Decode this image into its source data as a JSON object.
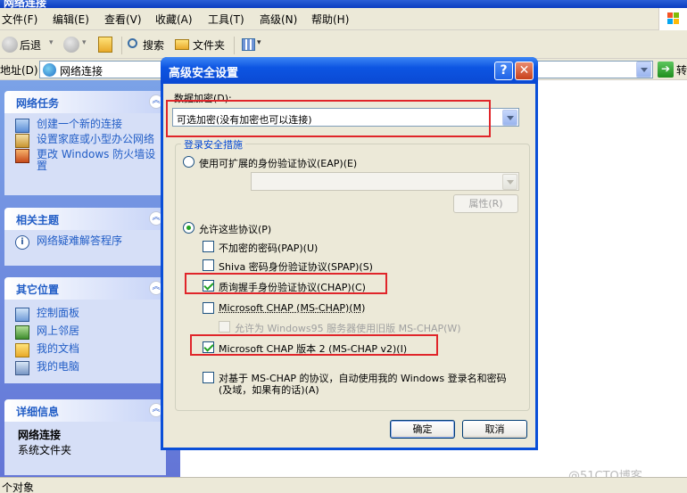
{
  "window": {
    "title": "网络连接"
  },
  "menubar": {
    "items": [
      "文件(F)",
      "编辑(E)",
      "查看(V)",
      "收藏(A)",
      "工具(T)",
      "高级(N)",
      "帮助(H)"
    ]
  },
  "toolbar": {
    "back": "后退",
    "search": "搜索",
    "folders": "文件夹"
  },
  "address": {
    "label": "地址(D)",
    "value": "网络连接",
    "go": "转"
  },
  "taskpane": {
    "network_tasks": {
      "title": "网络任务",
      "items": [
        "创建一个新的连接",
        "设置家庭或小型办公网络",
        "更改 Windows 防火墙设置"
      ]
    },
    "related": {
      "title": "相关主题",
      "items": [
        "网络疑难解答程序"
      ]
    },
    "other_places": {
      "title": "其它位置",
      "items": [
        "控制面板",
        "网上邻居",
        "我的文档",
        "我的电脑"
      ]
    },
    "details": {
      "title": "详细信息",
      "name": "网络连接",
      "type": "系统文件夹"
    }
  },
  "status": {
    "text": "个对象"
  },
  "watermark": "@51CTO博客",
  "dialog": {
    "title": "高级安全设置",
    "help": "?",
    "close": "✕",
    "encryption_label": "数据加密(D):",
    "encryption_value": "可选加密(没有加密也可以连接)",
    "logon_group": "登录安全措施",
    "eap_radio": "使用可扩展的身份验证协议(EAP)(E)",
    "properties_button": "属性(R)",
    "allow_radio": "允许这些协议(P)",
    "protocols": [
      {
        "label": "不加密的密码(PAP)(U)",
        "checked": false
      },
      {
        "label": "Shiva 密码身份验证协议(SPAP)(S)",
        "checked": false
      },
      {
        "label": "质询握手身份验证协议(CHAP)(C)",
        "checked": true
      },
      {
        "label": "Microsoft CHAP (MS-CHAP)(M)",
        "checked": false
      }
    ],
    "win95_option": "允许为 Windows95 服务器使用旧版 MS-CHAP(W)",
    "mschapv2": "Microsoft CHAP 版本 2 (MS-CHAP v2)(I)",
    "auto_logon_line1": "对基于 MS-CHAP 的协议，自动使用我的 Windows 登录名和密码",
    "auto_logon_line2": "(及域，如果有的话)(A)",
    "ok": "确定",
    "cancel": "取消"
  },
  "colors": {
    "xp_blue": "#0a4fd8",
    "highlight_red": "#e0252a",
    "link_blue": "#215dc6"
  }
}
